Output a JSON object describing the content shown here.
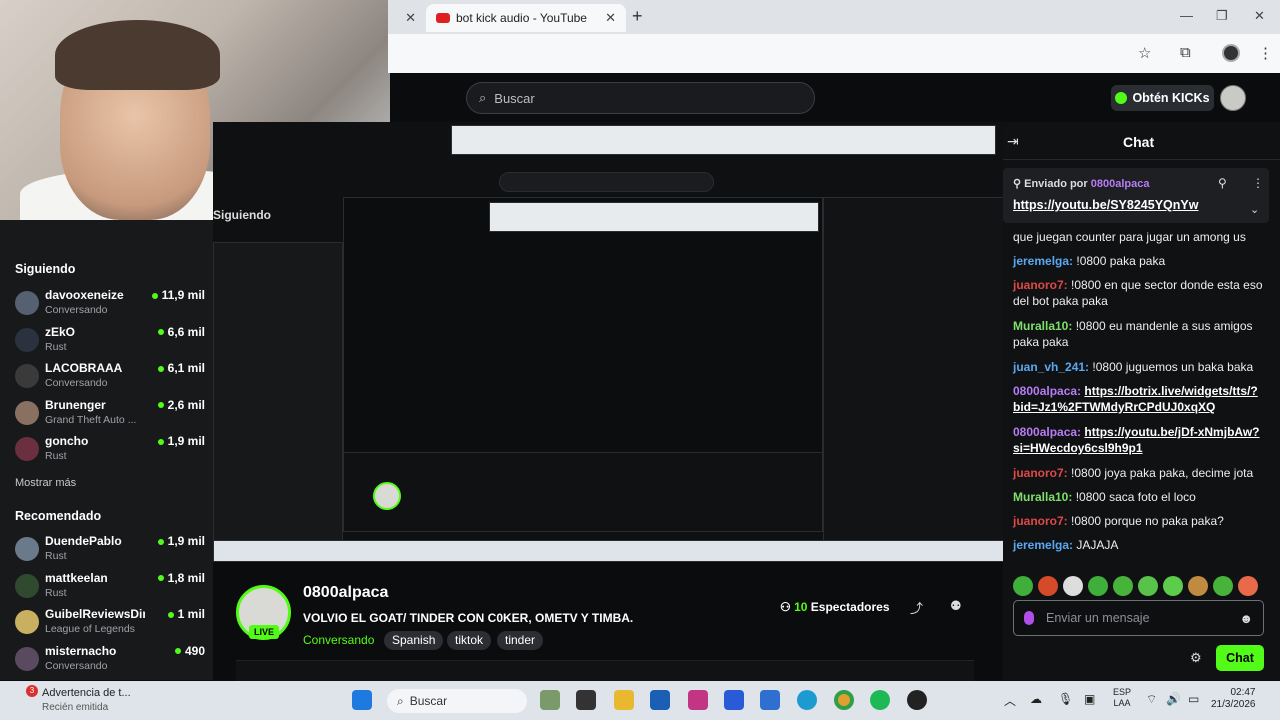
{
  "browser": {
    "tabs": [
      {
        "label": "bot kick audio - YouTube",
        "active": true
      }
    ]
  },
  "kick": {
    "search_placeholder": "Buscar",
    "kicks_button": "Obtén KICKs",
    "partial_heading": "Siguiendo"
  },
  "sidebar": {
    "following_title": "Siguiendo",
    "following": [
      {
        "name": "davooxeneize",
        "sub": "Conversando",
        "viewers": "11,9 mil",
        "color": "#556070"
      },
      {
        "name": "zEkO",
        "sub": "Rust",
        "viewers": "6,6 mil",
        "color": "#2a3240"
      },
      {
        "name": "LACOBRAAA",
        "sub": "Conversando",
        "viewers": "6,1 mil",
        "color": "#3a3a3a"
      },
      {
        "name": "Brunenger",
        "sub": "Grand Theft Auto ...",
        "viewers": "2,6 mil",
        "color": "#8a7060"
      },
      {
        "name": "goncho",
        "sub": "Rust",
        "viewers": "1,9 mil",
        "color": "#6a3040"
      }
    ],
    "show_more": "Mostrar más",
    "recommended_title": "Recomendado",
    "recommended": [
      {
        "name": "DuendePablo",
        "sub": "Rust",
        "viewers": "1,9 mil",
        "color": "#6a7a8a"
      },
      {
        "name": "mattkeelan",
        "sub": "Rust",
        "viewers": "1,8 mil",
        "color": "#304a30"
      },
      {
        "name": "GuibelReviewsDir...",
        "sub": "League of Legends",
        "viewers": "1 mil",
        "color": "#c9b060"
      },
      {
        "name": "misternacho",
        "sub": "Conversando",
        "viewers": "490",
        "color": "#5a4a60"
      }
    ]
  },
  "stream": {
    "streamer": "0800alpaca",
    "live_badge": "LIVE",
    "title": "VOLVIO EL GOAT/ TINDER CON C0KER, OMETV Y TIMBA.",
    "category": "Conversando",
    "tags": [
      "Spanish",
      "tiktok",
      "tinder"
    ],
    "viewers_count": "10",
    "viewers_label": "Espectadores"
  },
  "chat": {
    "title": "Chat",
    "pinned_by_label": "Enviado por",
    "pinned_user": "0800alpaca",
    "pinned_link": "https://youtu.be/SY8245YQnYw",
    "messages": [
      {
        "user": "",
        "color": "#fff",
        "text": "que juegan counter para jugar un among us"
      },
      {
        "user": "jeremelga:",
        "color": "#5aa8f0",
        "text": "!0800 paka paka"
      },
      {
        "user": "juanoro7:",
        "color": "#e04848",
        "text": "!0800 en que sector donde esta eso del bot paka paka"
      },
      {
        "user": "Muralla10:",
        "color": "#7ee06a",
        "text": "!0800 eu mandenle a sus amigos paka paka"
      },
      {
        "user": "juan_vh_241:",
        "color": "#5aa8f0",
        "text": "!0800 juguemos un baka baka"
      },
      {
        "user": "0800alpaca:",
        "color": "#b87cf5",
        "text": "https://botrix.live/widgets/tts/?bid=Jz1%2FTWMdyRrCPdUJ0xqXQ"
      },
      {
        "user": "0800alpaca:",
        "color": "#b87cf5",
        "text": "https://youtu.be/jDf-xNmjbAw?si=HWecdoy6csl9h9p1"
      },
      {
        "user": "juanoro7:",
        "color": "#e04848",
        "text": "!0800 joya paka paka, decime jota"
      },
      {
        "user": "Muralla10:",
        "color": "#7ee06a",
        "text": "!0800 saca foto el loco"
      },
      {
        "user": "juanoro7:",
        "color": "#e04848",
        "text": "!0800 porque no paka paka?"
      },
      {
        "user": "jeremelga:",
        "color": "#5aa8f0",
        "text": "JAJAJA"
      }
    ],
    "input_placeholder": "Enviar un mensaje",
    "send_button": "Chat"
  },
  "taskbar": {
    "notification_title": "Advertencia de t...",
    "notification_sub": "Recién emitida",
    "notification_count": "3",
    "search": "Buscar",
    "lang_1": "ESP",
    "lang_2": "LAA",
    "time": "02:47",
    "date": "21/3/2026"
  }
}
